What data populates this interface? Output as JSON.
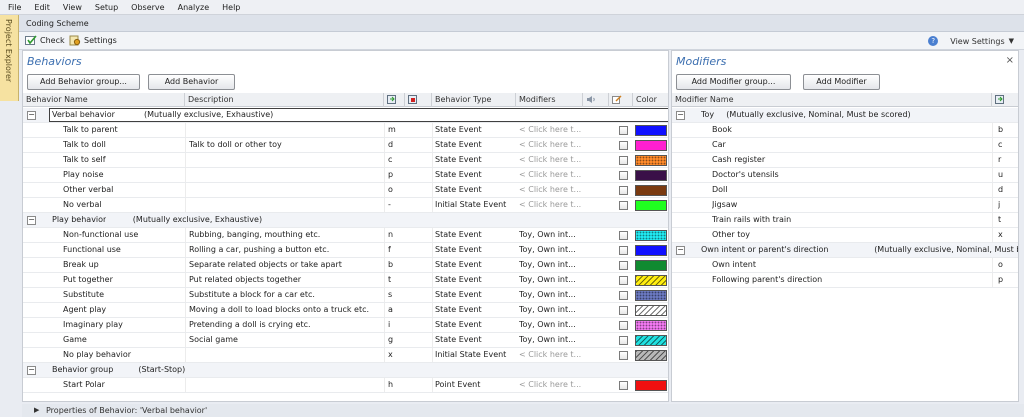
{
  "menu": [
    "File",
    "Edit",
    "View",
    "Setup",
    "Observe",
    "Analyze",
    "Help"
  ],
  "explorer_label": "Project Explorer",
  "doc_tab": "Coding Scheme",
  "toolbar": {
    "check": "Check",
    "settings": "Settings",
    "view_settings": "View Settings",
    "help_icon": "?"
  },
  "behaviors": {
    "title": "Behaviors",
    "add_group_button": "Add Behavior group...",
    "add_button": "Add Behavior",
    "columns": {
      "name": "Behavior Name",
      "description": "Description",
      "type": "Behavior Type",
      "modifiers": "Modifiers",
      "color": "Color"
    },
    "groups": [
      {
        "label": "Verbal behavior",
        "props": "(Mutually exclusive, Exhaustive)",
        "items": [
          {
            "name": "Talk to parent",
            "desc": "",
            "key": "m",
            "type": "State Event",
            "mods": "< Click here t...",
            "color": "#1010ff",
            "pattern": "solid"
          },
          {
            "name": "Talk to doll",
            "desc": "Talk to doll or other toy",
            "key": "d",
            "type": "State Event",
            "mods": "< Click here t...",
            "color": "#ff1fd0",
            "pattern": "solid"
          },
          {
            "name": "Talk to self",
            "desc": "",
            "key": "c",
            "type": "State Event",
            "mods": "< Click here t...",
            "color": "#ff8a2a",
            "pattern": "dots"
          },
          {
            "name": "Play noise",
            "desc": "",
            "key": "p",
            "type": "State Event",
            "mods": "< Click here t...",
            "color": "#3a1048",
            "pattern": "solid"
          },
          {
            "name": "Other verbal",
            "desc": "",
            "key": "o",
            "type": "State Event",
            "mods": "< Click here t...",
            "color": "#7a3a10",
            "pattern": "solid"
          },
          {
            "name": "No verbal",
            "desc": "",
            "key": "-",
            "type": "Initial State Event",
            "mods": "< Click here t...",
            "color": "#20ff20",
            "pattern": "solid"
          }
        ]
      },
      {
        "label": "Play behavior",
        "props": "(Mutually exclusive, Exhaustive)",
        "items": [
          {
            "name": "Non-functional use",
            "desc": "Rubbing, banging, mouthing etc.",
            "key": "n",
            "type": "State Event",
            "mods": "Toy, Own int...",
            "color": "#20e8f0",
            "pattern": "dots"
          },
          {
            "name": "Functional use",
            "desc": "Rolling a car, pushing a button etc.",
            "key": "f",
            "type": "State Event",
            "mods": "Toy, Own int...",
            "color": "#1010ff",
            "pattern": "solid"
          },
          {
            "name": "Break up",
            "desc": "Separate related objects or take apart",
            "key": "b",
            "type": "State Event",
            "mods": "Toy, Own int...",
            "color": "#108a30",
            "pattern": "solid"
          },
          {
            "name": "Put together",
            "desc": "Put related objects together",
            "key": "t",
            "type": "State Event",
            "mods": "Toy, Own int...",
            "color": "#ffee10",
            "pattern": "hatch"
          },
          {
            "name": "Substitute",
            "desc": "Substitute a block for a car etc.",
            "key": "s",
            "type": "State Event",
            "mods": "Toy, Own int...",
            "color": "#6a78c0",
            "pattern": "dots"
          },
          {
            "name": "Agent play",
            "desc": "Moving a doll to load blocks onto a truck etc.",
            "key": "a",
            "type": "State Event",
            "mods": "Toy, Own int...",
            "color": "#ffffff",
            "pattern": "hatch"
          },
          {
            "name": "Imaginary play",
            "desc": "Pretending a doll is crying etc.",
            "key": "i",
            "type": "State Event",
            "mods": "Toy, Own int...",
            "color": "#f078f0",
            "pattern": "dots"
          },
          {
            "name": "Game",
            "desc": "Social game",
            "key": "g",
            "type": "State Event",
            "mods": "Toy, Own int...",
            "color": "#20e0e0",
            "pattern": "hatch"
          },
          {
            "name": "No play behavior",
            "desc": "",
            "key": "x",
            "type": "Initial State Event",
            "mods": "< Click here t...",
            "color": "#b8b8b8",
            "pattern": "hatch"
          }
        ]
      },
      {
        "label": "Behavior group",
        "props": "(Start-Stop)",
        "items": [
          {
            "name": "Start Polar",
            "desc": "",
            "key": "h",
            "type": "Point Event",
            "mods": "< Click here t...",
            "color": "#f01010",
            "pattern": "solid"
          }
        ]
      }
    ]
  },
  "modifiers": {
    "title": "Modifiers",
    "close": "×",
    "add_group_button": "Add Modifier group...",
    "add_button": "Add Modifier",
    "columns": {
      "name": "Modifier Name"
    },
    "groups": [
      {
        "label": "Toy",
        "props": "(Mutually exclusive, Nominal, Must be scored)",
        "items": [
          {
            "name": "Book",
            "key": "b"
          },
          {
            "name": "Car",
            "key": "c"
          },
          {
            "name": "Cash register",
            "key": "r"
          },
          {
            "name": "Doctor's utensils",
            "key": "u"
          },
          {
            "name": "Doll",
            "key": "d"
          },
          {
            "name": "Jigsaw",
            "key": "j"
          },
          {
            "name": "Train rails with train",
            "key": "t"
          },
          {
            "name": "Other toy",
            "key": "x"
          }
        ]
      },
      {
        "label": "Own intent or parent's direction",
        "props": "(Mutually exclusive, Nominal, Must be scored)",
        "items": [
          {
            "name": "Own intent",
            "key": "o"
          },
          {
            "name": "Following parent's direction",
            "key": "p"
          }
        ]
      }
    ]
  },
  "bottom": {
    "properties_label": "Properties of Behavior: 'Verbal behavior'"
  }
}
